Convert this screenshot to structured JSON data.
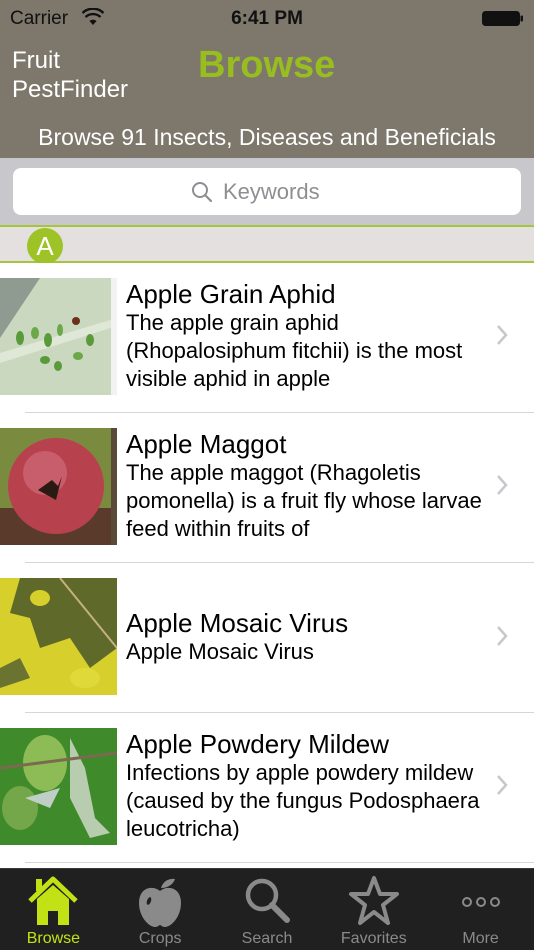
{
  "status_bar": {
    "carrier": "Carrier",
    "time": "6:41 PM"
  },
  "header": {
    "app_name_line1": "Fruit",
    "app_name_line2": "PestFinder",
    "title": "Browse",
    "subtitle": "Browse 91 Insects, Diseases and Beneficials"
  },
  "search": {
    "placeholder": "Keywords",
    "value": ""
  },
  "section": {
    "letter": "A"
  },
  "items": [
    {
      "title": "Apple Grain Aphid",
      "description": "The apple grain aphid (Rhopalosiphum fitchii) is the most visible aphid in apple",
      "image": "leaf-with-aphids"
    },
    {
      "title": "Apple Maggot",
      "description": "The apple maggot (Rhagoletis pomonella) is a fruit fly whose larvae feed within fruits of",
      "image": "red-apple-with-fly"
    },
    {
      "title": "Apple Mosaic Virus",
      "description": "Apple Mosaic Virus",
      "image": "yellow-mottled-leaf"
    },
    {
      "title": "Apple Powdery Mildew",
      "description": "Infections by apple powdery mildew (caused by the fungus Podosphaera leucotricha)",
      "image": "mildew-leaves"
    }
  ],
  "tabs": [
    {
      "label": "Browse",
      "icon": "house-icon",
      "active": true
    },
    {
      "label": "Crops",
      "icon": "apple-icon",
      "active": false
    },
    {
      "label": "Search",
      "icon": "magnifier-icon",
      "active": false
    },
    {
      "label": "Favorites",
      "icon": "star-icon",
      "active": false
    },
    {
      "label": "More",
      "icon": "more-dots-icon",
      "active": false
    }
  ],
  "colors": {
    "header_bg": "#7d776c",
    "accent_green": "#98bd1f",
    "tab_active": "#c3e216",
    "tab_inactive": "#8a8a8a",
    "tabbar_bg": "#202020"
  }
}
